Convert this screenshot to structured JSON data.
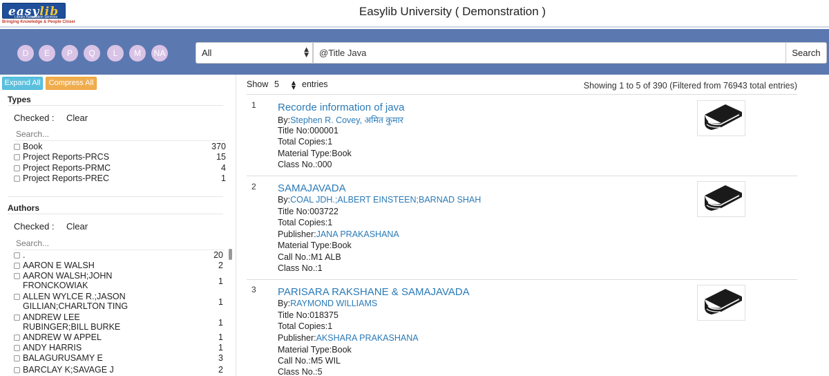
{
  "app": {
    "title": "Easylib University ( Demonstration )",
    "logo_text_a": "easy",
    "logo_text_b": "lib",
    "logo_sub": "Library Automation Services",
    "logo_tag": "Bringing Knowledge & People Closer"
  },
  "alpha_buttons": [
    "D",
    "E",
    "P",
    "Q",
    "L",
    "M",
    "NA"
  ],
  "search": {
    "field": "All",
    "query": "@Title Java",
    "button": "Search"
  },
  "toolbar": {
    "expand_all": "Expand All",
    "compress_all": "Compress All"
  },
  "types": {
    "heading": "Types",
    "checked_label": "Checked :",
    "clear_label": "Clear",
    "search_placeholder": "Search...",
    "items": [
      {
        "label": "Book",
        "count": "370"
      },
      {
        "label": "Project Reports-PRCS",
        "count": "15"
      },
      {
        "label": "Project Reports-PRMC",
        "count": "4"
      },
      {
        "label": "Project Reports-PREC",
        "count": "1"
      }
    ]
  },
  "authors": {
    "heading": "Authors",
    "checked_label": "Checked :",
    "clear_label": "Clear",
    "search_placeholder": "Search...",
    "items": [
      {
        "label": ".",
        "count": "20"
      },
      {
        "label": "AARON E WALSH",
        "count": "2"
      },
      {
        "label": "AARON WALSH;JOHN FRONCKOWIAK",
        "count": "1"
      },
      {
        "label": "ALLEN WYLCE R.;JASON GILLIAN;CHARLTON TING",
        "count": "1"
      },
      {
        "label": "ANDREW LEE RUBINGER;BILL BURKE",
        "count": "1"
      },
      {
        "label": "ANDREW W APPEL",
        "count": "1"
      },
      {
        "label": "ANDY HARRIS",
        "count": "1"
      },
      {
        "label": "BALAGURUSAMY E",
        "count": "3"
      },
      {
        "label": "BARCLAY K;SAVAGE J",
        "count": "2"
      }
    ]
  },
  "results_header": {
    "show_label": "Show",
    "page_size": "5",
    "entries_label": "entries",
    "summary": "Showing 1 to 5 of 390 (Filtered from 76943 total entries)"
  },
  "results": [
    {
      "num": "1",
      "title": "Recorde information of java",
      "lines": [
        {
          "label": "By:",
          "value": "Stephen R. Covey, अमित कुमार",
          "link": true
        },
        {
          "label": "Title No:",
          "value": "000001",
          "link": false
        },
        {
          "label": "Total Copies:",
          "value": "1",
          "link": false
        },
        {
          "label": "Material Type:",
          "value": "Book",
          "link": false
        },
        {
          "label": "Class No.:",
          "value": "000",
          "link": false
        }
      ]
    },
    {
      "num": "2",
      "title": "SAMAJAVADA",
      "lines": [
        {
          "label": "By:",
          "value": "COAL JDH.;ALBERT EINSTEEN;BARNAD SHAH",
          "link": true
        },
        {
          "label": "Title No:",
          "value": "003722",
          "link": false
        },
        {
          "label": "Total Copies:",
          "value": "1",
          "link": false
        },
        {
          "label": "Publisher:",
          "value": "JANA PRAKASHANA",
          "link": true
        },
        {
          "label": "Material Type:",
          "value": "Book",
          "link": false
        },
        {
          "label": "Call No.:",
          "value": "M1 ALB",
          "link": false
        },
        {
          "label": "Class No.:",
          "value": "1",
          "link": false
        }
      ]
    },
    {
      "num": "3",
      "title": "PARISARA RAKSHANE & SAMAJAVADA",
      "lines": [
        {
          "label": "By:",
          "value": "RAYMOND WILLIAMS",
          "link": true
        },
        {
          "label": "Title No:",
          "value": "018375",
          "link": false
        },
        {
          "label": "Total Copies:",
          "value": "1",
          "link": false
        },
        {
          "label": "Publisher:",
          "value": "AKSHARA PRAKASHANA",
          "link": true
        },
        {
          "label": "Material Type:",
          "value": "Book",
          "link": false
        },
        {
          "label": "Call No.:",
          "value": "M5 WIL",
          "link": false
        },
        {
          "label": "Class No.:",
          "value": "5",
          "link": false
        }
      ]
    }
  ]
}
